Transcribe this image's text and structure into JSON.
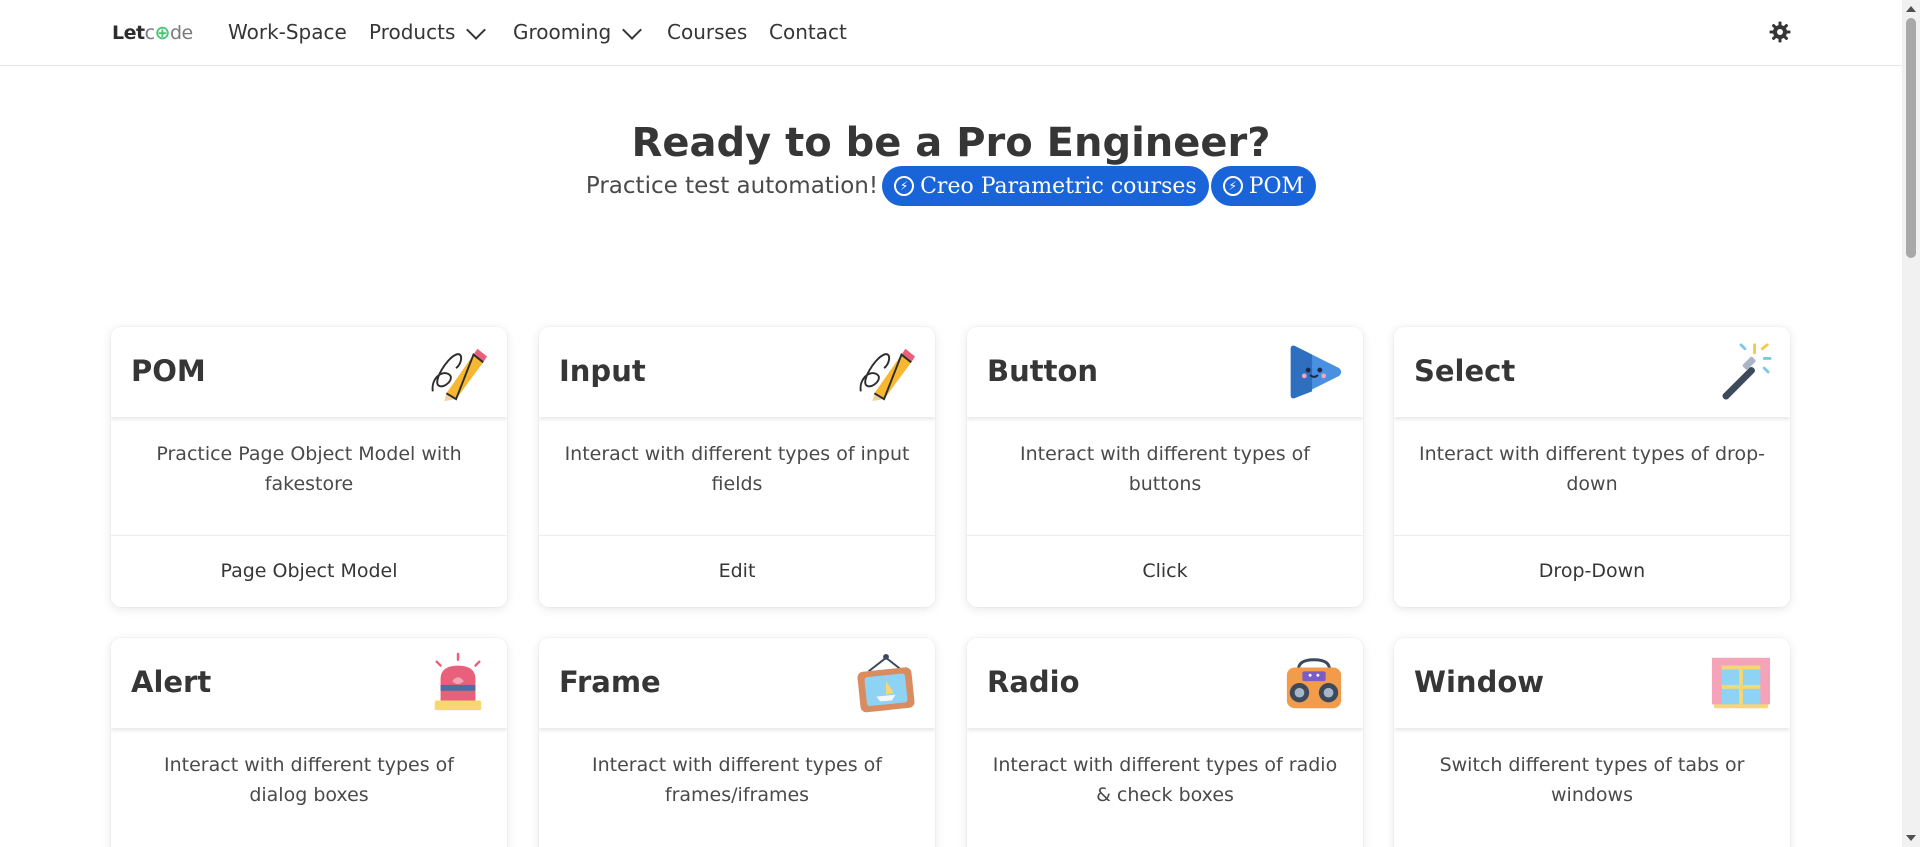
{
  "nav": {
    "brand": {
      "part1": "Let",
      "part2": "c",
      "part3": "de"
    },
    "items": [
      {
        "label": "Work-Space"
      },
      {
        "label": "Products"
      },
      {
        "label": "Grooming"
      },
      {
        "label": "Courses"
      },
      {
        "label": "Contact"
      }
    ],
    "theme_icon": "gear-icon"
  },
  "hero": {
    "title": "Ready to be a Pro Engineer?",
    "subtitle": "Practice test automation!",
    "pills": [
      {
        "label": "Creo Parametric courses",
        "icon": "bolt-icon"
      },
      {
        "label": "POM",
        "icon": "bolt-icon"
      }
    ],
    "accent": "#1864d8"
  },
  "cards": [
    {
      "title": "POM",
      "description": "Practice Page Object Model with fakestore",
      "action": "Page Object Model",
      "icon": "pencil-icon"
    },
    {
      "title": "Input",
      "description": "Interact with different types of input fields",
      "action": "Edit",
      "icon": "pencil-icon"
    },
    {
      "title": "Button",
      "description": "Interact with different types of buttons",
      "action": "Click",
      "icon": "play-button-icon"
    },
    {
      "title": "Select",
      "description": "Interact with different types of drop-down",
      "action": "Drop-Down",
      "icon": "magic-wand-icon"
    },
    {
      "title": "Alert",
      "description": "Interact with different types of dialog boxes",
      "action": "",
      "icon": "siren-icon"
    },
    {
      "title": "Frame",
      "description": "Interact with different types of frames/iframes",
      "action": "",
      "icon": "picture-frame-icon"
    },
    {
      "title": "Radio",
      "description": "Interact with different types of radio & check boxes",
      "action": "",
      "icon": "radio-icon"
    },
    {
      "title": "Window",
      "description": "Switch different types of tabs or windows",
      "action": "",
      "icon": "window-icon"
    }
  ]
}
